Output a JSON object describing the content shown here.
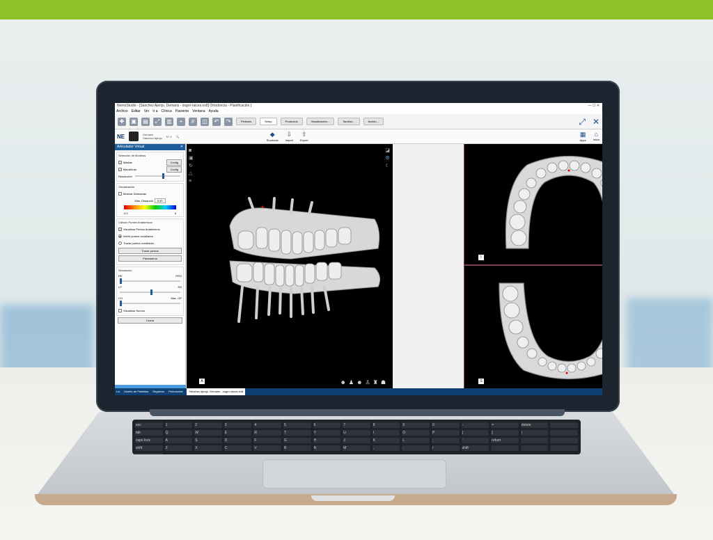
{
  "app": {
    "title": "NemoStudio - [Sánchez Ajenjo, Demaris - osgrn-raices.nx8] Ortodoncia - Planificación ]",
    "window_controls": "—  ☐  ✕",
    "menu": [
      "Archivo",
      "Editar",
      "Ver",
      "Ir a",
      "Clínica",
      "Paciente",
      "Ventana",
      "Ayuda"
    ],
    "tabs": [
      "Pintinois",
      "Setup",
      "Productos",
      "Visualización...",
      "Tamños...",
      "Acción..."
    ],
    "active_tab": "Setup"
  },
  "patient": {
    "logo": "NE",
    "first_name": "Demaris",
    "last_name": "Sánchez Ajenjo",
    "number": "N° 0"
  },
  "toolbar_right": {
    "shortcuts_label": "Shortcuts",
    "import_label": "Import",
    "export_label": "Export",
    "apps_label": "Apps",
    "home_label": "Inicio"
  },
  "panel": {
    "title": "Articulador Virtual",
    "models_section": "Selección de Modelos",
    "maxilar": "Maxilar",
    "mandibula": "Mandíbula",
    "config": "Config",
    "resolucion": "Resolución",
    "visualizacion_section": "Visualización",
    "mostrar_distancias": "Mostrar Distancias",
    "max_distancia": "Max. Distancia",
    "max_distancia_value": "5,00",
    "scale_min": "0.0",
    "scale_max": "5",
    "calculo_section": "Cálculo Puntos Anatómicos",
    "visualizar_puntos": "Visualizar Puntos Anatómicos",
    "inferir_puntos": "Inferir puntos condilares",
    "trazar_puntos_opt": "Trazar puntos condilares",
    "trazar_puntos_btn": "Trazar puntos",
    "parametros_btn": "Parámetros",
    "simulacion_section": "Simulación",
    "re": "RE",
    "pro": "PRO",
    "lp": "LP",
    "rs": "RS",
    "co": "CO",
    "max_op": "Max. OP",
    "visualizar_surcos": "Visualizar Surcos",
    "cerrar": "Cerrar"
  },
  "viewports": {
    "top_label": "I",
    "bottom_label": "S",
    "left_label": "A"
  },
  "statusbar": [
    "Lis",
    "Diseño de Plantillas",
    "Registros",
    "Periodontal",
    "Sánchez Ajenjo, Demaris - osgrn-raices.nx8"
  ],
  "keyboard": [
    "esc",
    "1",
    "2",
    "3",
    "4",
    "5",
    "6",
    "7",
    "8",
    "9",
    "0",
    "-",
    "=",
    "delete",
    "",
    "tab",
    "Q",
    "W",
    "E",
    "R",
    "T",
    "Y",
    "U",
    "I",
    "O",
    "P",
    "[",
    "]",
    "\\",
    "",
    "caps lock",
    "A",
    "S",
    "D",
    "F",
    "G",
    "H",
    "J",
    "K",
    "L",
    ";",
    "'",
    "return",
    "",
    "",
    "shift",
    "Z",
    "X",
    "C",
    "V",
    "B",
    "N",
    "M",
    ",",
    ".",
    "/",
    "shift",
    "",
    "",
    "",
    ""
  ]
}
